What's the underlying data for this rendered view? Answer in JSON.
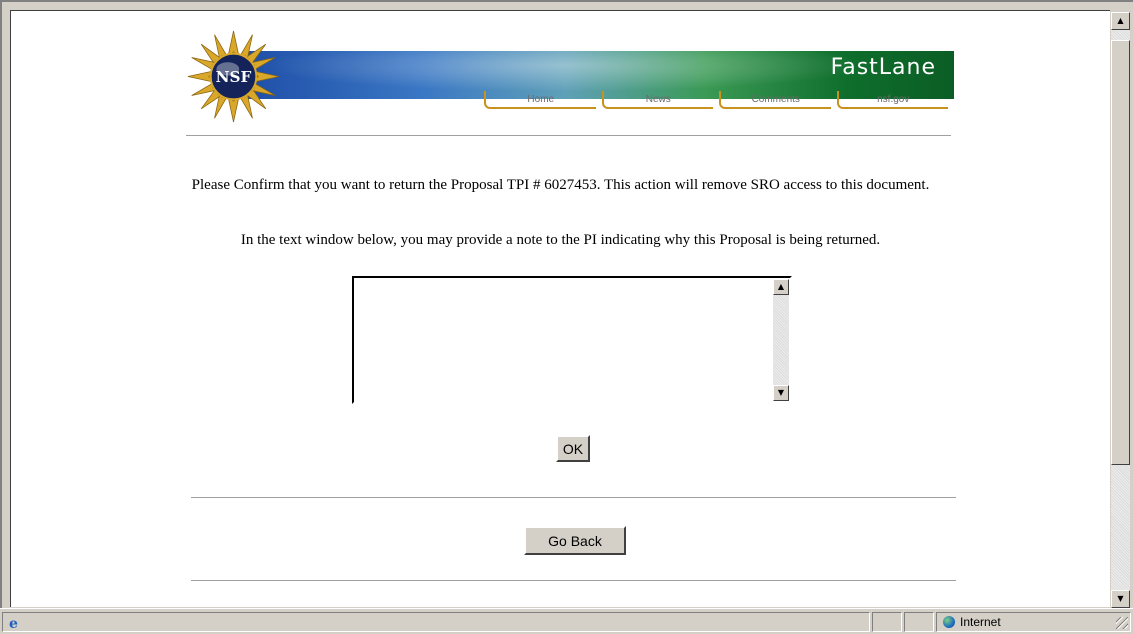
{
  "banner": {
    "seal_text": "NSF",
    "brand": "FastLane",
    "nav": [
      "Home",
      "News",
      "Comments",
      "nsf.gov"
    ]
  },
  "main": {
    "confirm_text": "Please Confirm that you want to return the Proposal TPI # 6027453. This action will remove SRO access to this document.",
    "note_instruction": "In the text window below, you may provide a note to the PI indicating why this Proposal is being  returned.",
    "note_value": "",
    "ok_label": "OK",
    "go_back_label": "Go Back"
  },
  "statusbar": {
    "zone_label": "Internet"
  },
  "colors": {
    "nav_accent": "#c9921e",
    "banner_green": "#0b5d25",
    "banner_blue": "#1f4fa8"
  },
  "icons": {
    "seal": "nsf-seal-icon",
    "browser": "ie-page-icon",
    "zone": "globe-icon"
  }
}
